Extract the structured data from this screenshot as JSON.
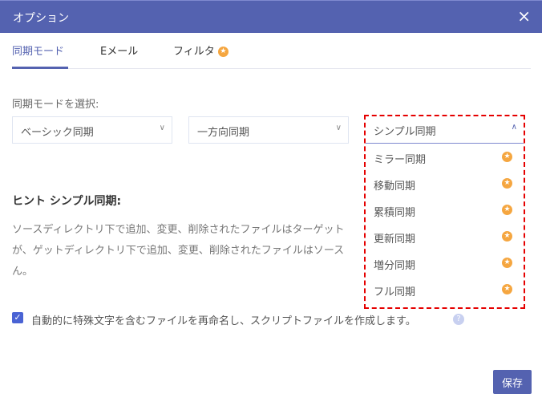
{
  "window": {
    "title": "オプション",
    "close_icon": "×"
  },
  "tabs": [
    {
      "label": "同期モード"
    },
    {
      "label": "Eメール"
    },
    {
      "label": "フィルタ"
    }
  ],
  "sync": {
    "label": "同期モードを選択:",
    "select1": "ベーシック同期",
    "select2": "一方向同期",
    "select3": "シンプル同期"
  },
  "dropdown": {
    "options": [
      "ミラー同期",
      "移動同期",
      "累積同期",
      "更新同期",
      "増分同期",
      "フル同期"
    ]
  },
  "hint": {
    "title": "ヒント シンプル同期:",
    "lines": [
      "ソースディレクトリ下で追加、変更、削除されたファイルはターゲット",
      "が、ゲットディレクトリ下で追加、変更、削除されたファイルはソース",
      "ん。"
    ]
  },
  "checkbox": {
    "label": "自動的に特殊文字を含むファイルを再命名し、スクリプトファイルを作成します。",
    "checked": true
  },
  "footer": {
    "save": "保存"
  },
  "colors": {
    "accent": "#5462b0",
    "premium": "#f5a640",
    "highlight": "#e50000"
  }
}
